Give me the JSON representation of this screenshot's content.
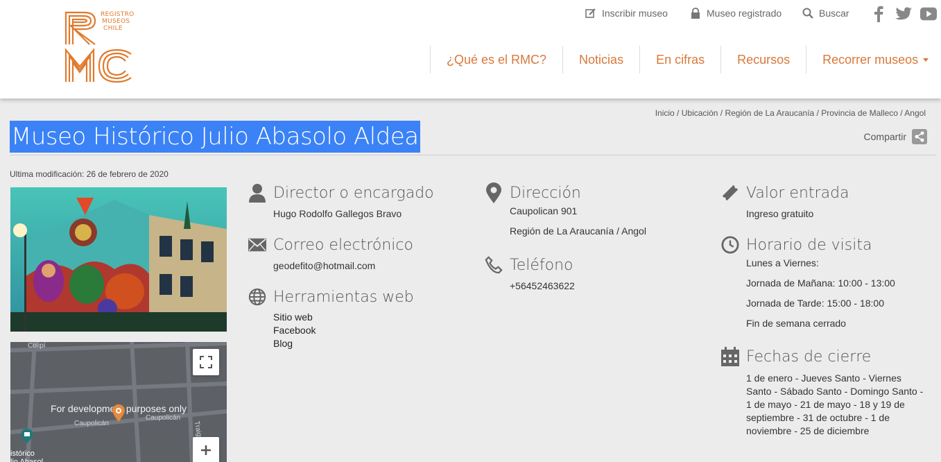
{
  "header": {
    "logo": {
      "text_lines": [
        "REGISTRO",
        "MUSEOS",
        "CHILE"
      ],
      "mark": "RMC"
    },
    "util_links": [
      {
        "label": "Inscribir museo",
        "icon": "edit-icon"
      },
      {
        "label": "Museo registrado",
        "icon": "lock-icon"
      },
      {
        "label": "Buscar",
        "icon": "search-icon"
      }
    ],
    "social": [
      "facebook-icon",
      "twitter-icon",
      "youtube-icon"
    ],
    "nav": [
      "¿Qué es el RMC?",
      "Noticias",
      "En cifras",
      "Recursos",
      "Recorrer museos"
    ]
  },
  "breadcrumb": {
    "items": [
      "Inicio",
      "Ubicación",
      "Región de La Araucanía",
      "Provincia de Malleco",
      "Angol"
    ],
    "separator": " / "
  },
  "page": {
    "title": "Museo Histórico Julio Abasolo Aldea",
    "share_label": "Compartir",
    "modified": "Ultima modificación: 26 de febrero de 2020"
  },
  "map": {
    "dev_text": "For development purposes only",
    "streets": [
      "Colipí",
      "Caupolicán",
      "Caupolicán",
      "Traiguén"
    ],
    "place": "istórico\nlio Abasol"
  },
  "info": {
    "director": {
      "heading": "Director o encargado",
      "value": "Hugo Rodolfo Gallegos Bravo"
    },
    "email": {
      "heading": "Correo electrónico",
      "value": "geodefito@hotmail.com"
    },
    "web": {
      "heading": "Herramientas web",
      "links": [
        "Sitio web",
        "Facebook",
        "Blog"
      ]
    },
    "address": {
      "heading": "Dirección",
      "line1": "Caupolican 901",
      "line2": "Región de La Araucanía / Angol"
    },
    "phone": {
      "heading": "Teléfono",
      "value": "+56452463622"
    },
    "entry": {
      "heading": "Valor entrada",
      "value": "Ingreso gratuito"
    },
    "hours": {
      "heading": "Horario de visita",
      "lines": [
        "Lunes a Viernes:",
        "Jornada de Mañana: 10:00 - 13:00",
        "Jornada de Tarde: 15:00 - 18:00",
        "Fin de semana cerrado"
      ]
    },
    "closing": {
      "heading": "Fechas de cierre",
      "text": "1 de enero - Jueves Santo - Viernes Santo - Sábado Santo - Domingo Santo - 1 de mayo - 21 de mayo - 18 y 19 de septiembre - 31 de octubre - 1 de noviembre - 25 de diciembre"
    }
  },
  "colors": {
    "accent": "#d9783a",
    "selection": "#3b82f6",
    "icon_gray": "#666666"
  }
}
